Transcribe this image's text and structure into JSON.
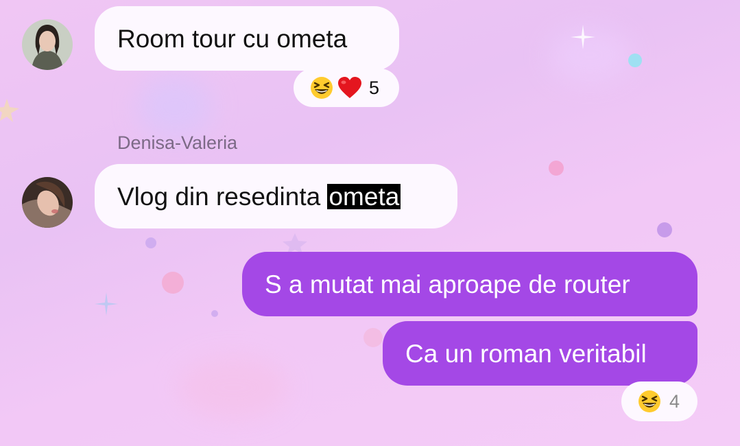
{
  "messages": [
    {
      "text": "Room tour cu ometa",
      "reactions": {
        "emojis": [
          "grinning-squinting-face",
          "red-heart"
        ],
        "count": "5"
      }
    },
    {
      "sender": "Denisa-Valeria",
      "text_before": "Vlog din resedinta ",
      "highlighted": "ometa"
    },
    {
      "text": "S a mutat mai aproape de router"
    },
    {
      "text": "Ca un roman veritabil",
      "reactions": {
        "emojis": [
          "grinning-squinting-face"
        ],
        "count": "4"
      }
    }
  ],
  "colors": {
    "incoming_bubble": "#fdf8ff",
    "outgoing_bubble": "#a448e6",
    "highlight": "#000000"
  }
}
